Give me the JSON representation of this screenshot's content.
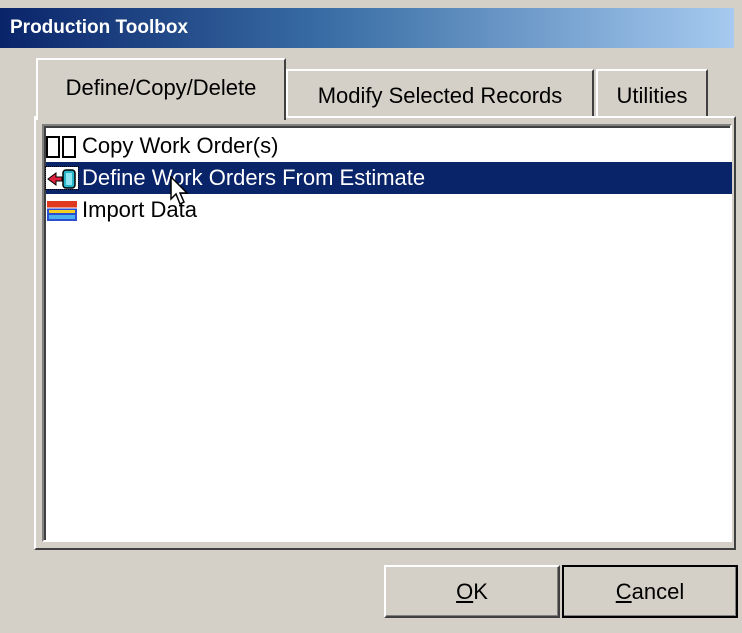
{
  "window": {
    "title": "Production Toolbox"
  },
  "tabs": [
    {
      "label": "Define/Copy/Delete",
      "active": true
    },
    {
      "label": "Modify Selected Records",
      "active": false
    },
    {
      "label": "Utilities",
      "active": false
    }
  ],
  "list": {
    "items": [
      {
        "label": "Copy Work Order(s)",
        "icon": "copy-records-icon",
        "selected": false
      },
      {
        "label": "Define Work Orders From Estimate",
        "icon": "define-from-estimate-icon",
        "selected": true
      },
      {
        "label": "Import Data",
        "icon": "import-data-icon",
        "selected": false
      }
    ]
  },
  "buttons": {
    "ok_mnemonic": "O",
    "ok_rest": "K",
    "cancel_mnemonic": "C",
    "cancel_rest": "ancel"
  },
  "colors": {
    "title_start": "#0a246a",
    "title_end": "#a6caf0",
    "selection": "#0a246a",
    "face": "#d4d0c8"
  }
}
